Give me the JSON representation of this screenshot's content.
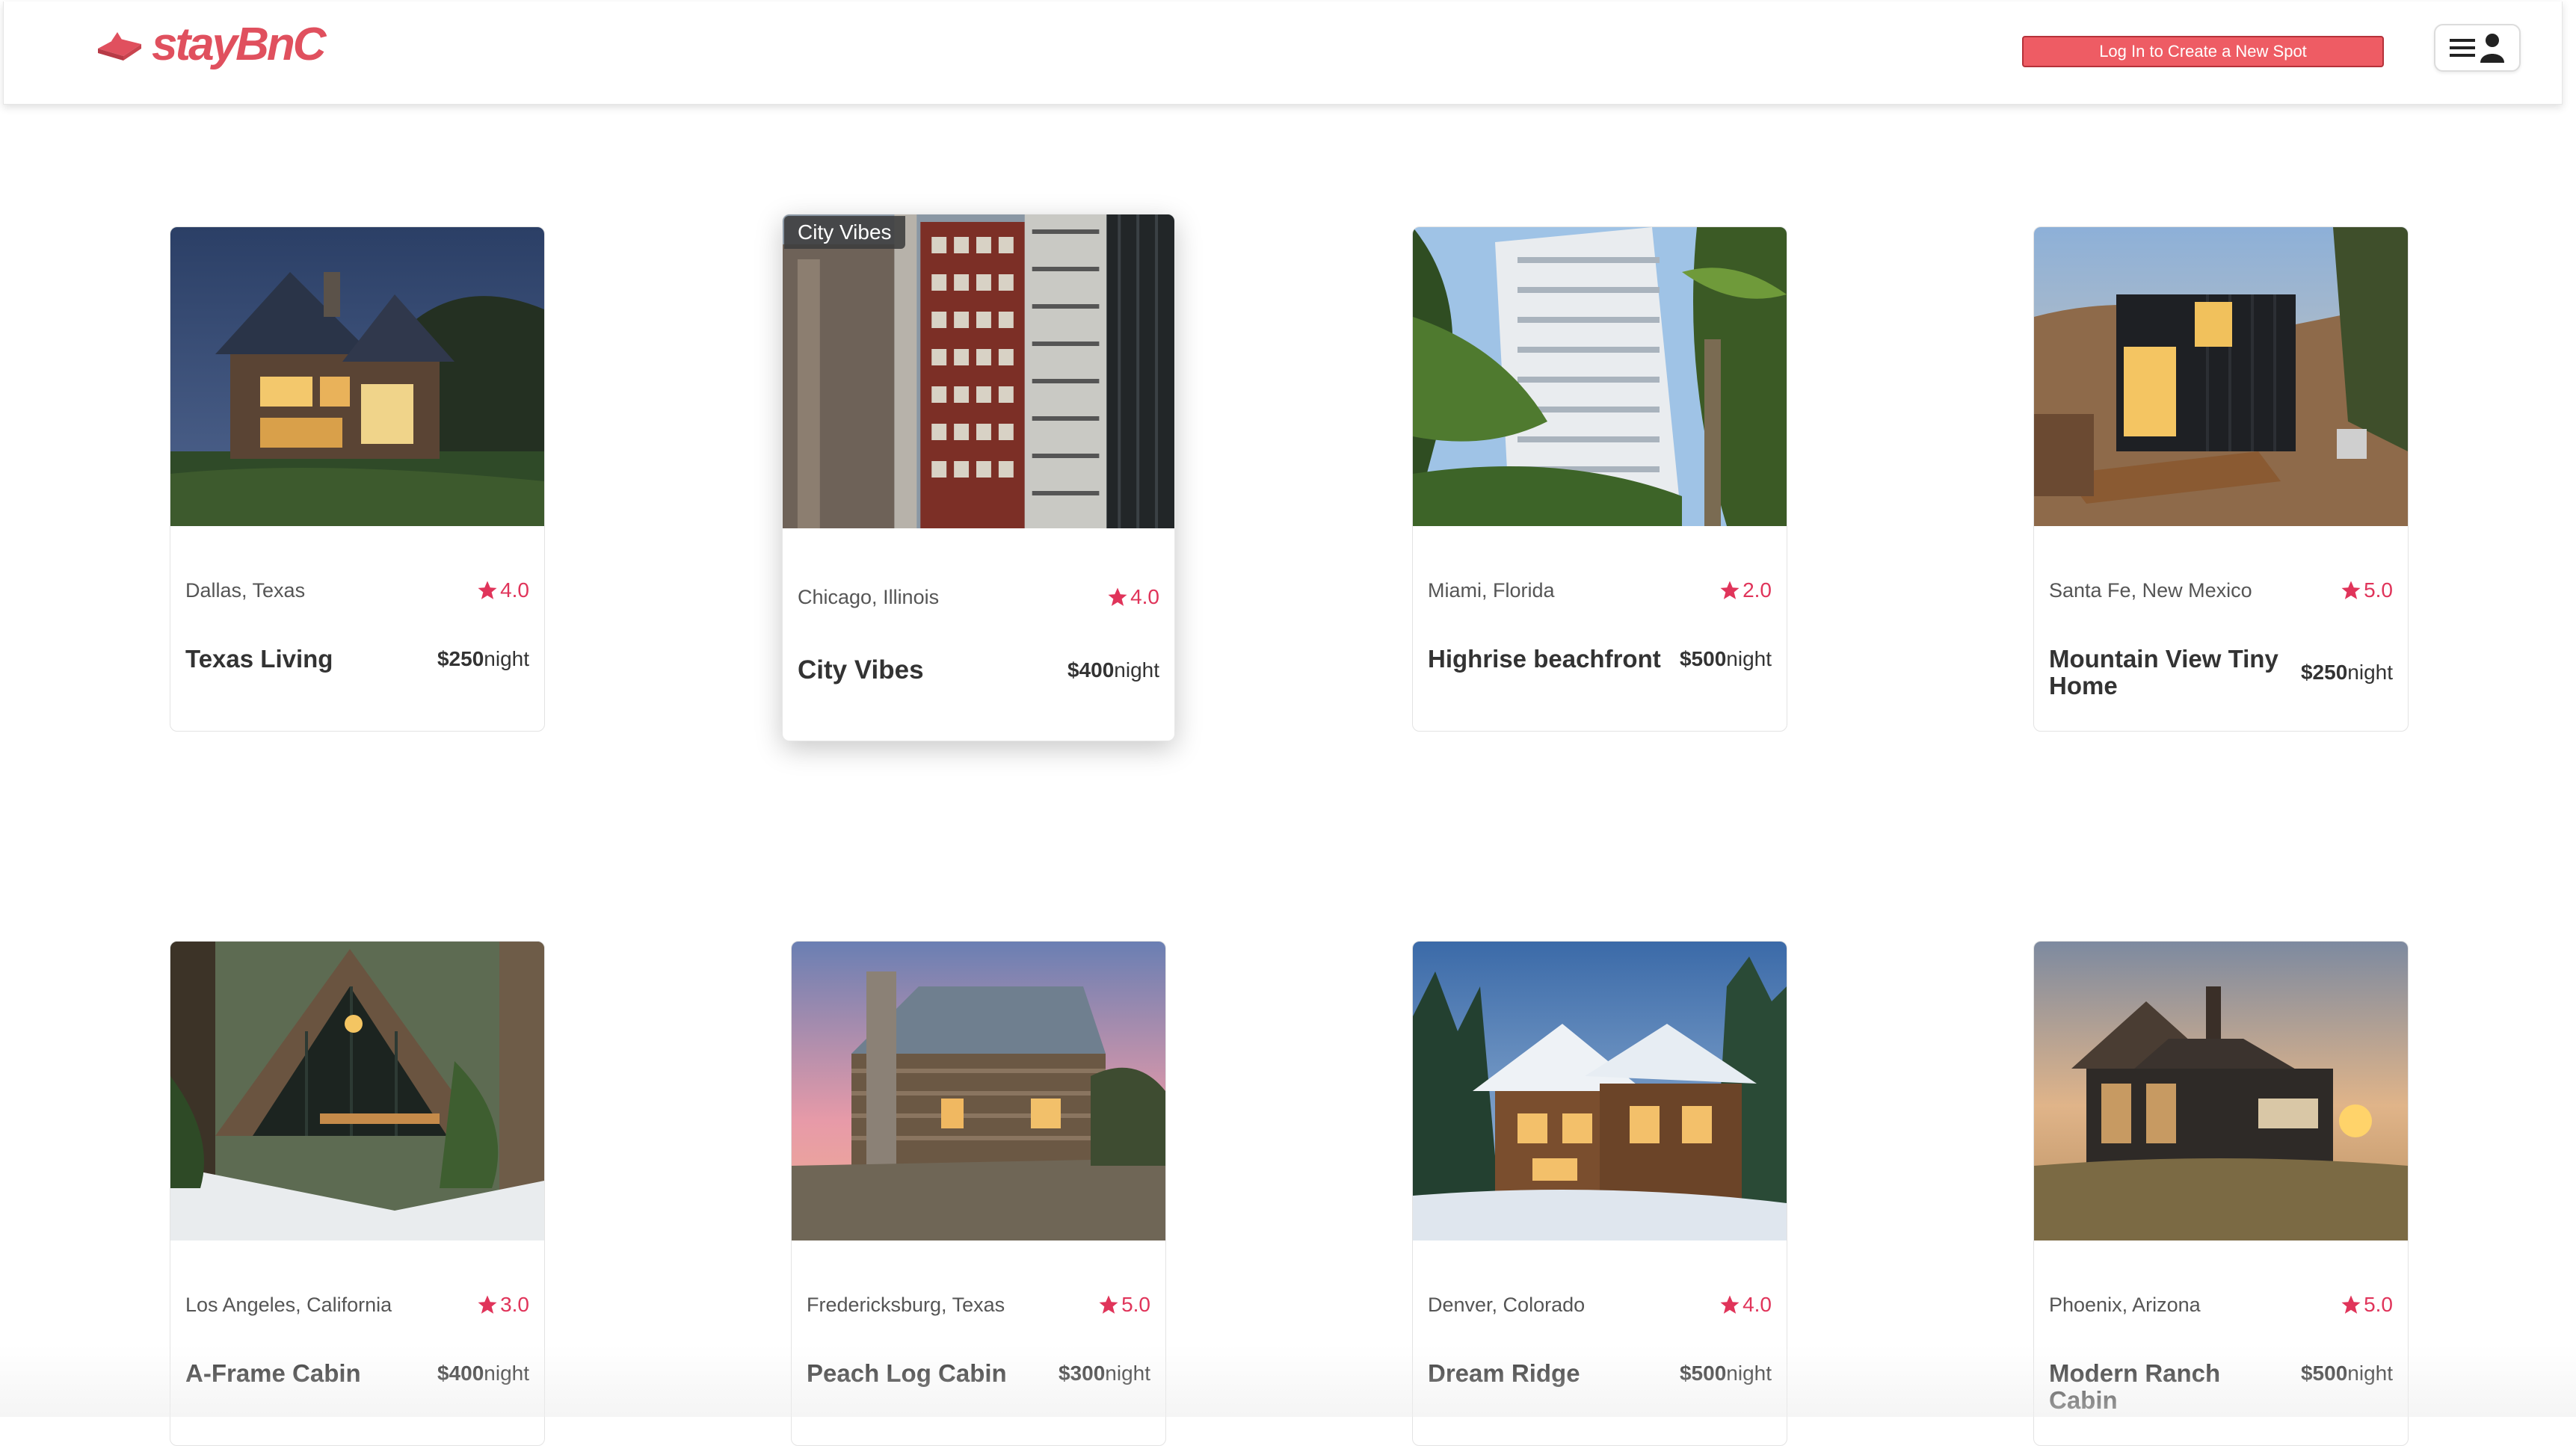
{
  "header": {
    "logo_text": "stayBnC",
    "create_spot_label": "Log In to Create a New Spot",
    "menu_icons": [
      "hamburger-icon",
      "user-icon"
    ]
  },
  "colors": {
    "brand": "#e0505e",
    "button": "#ee5c64",
    "star": "#e0345a"
  },
  "spots": [
    {
      "location": "Dallas, Texas",
      "rating": "4.0",
      "name": "Texas Living",
      "price": "$250",
      "unit": "night"
    },
    {
      "location": "Chicago, Illinois",
      "rating": "4.0",
      "name": "City Vibes",
      "price": "$400",
      "unit": "night",
      "tooltip": "City Vibes"
    },
    {
      "location": "Miami, Florida",
      "rating": "2.0",
      "name": "Highrise beachfront",
      "price": "$500",
      "unit": "night"
    },
    {
      "location": "Santa Fe, New Mexico",
      "rating": "5.0",
      "name": "Mountain View Tiny Home",
      "price": "$250",
      "unit": "night"
    },
    {
      "location": "Los Angeles, California",
      "rating": "3.0",
      "name": "A-Frame Cabin",
      "price": "$400",
      "unit": "night"
    },
    {
      "location": "Fredericksburg, Texas",
      "rating": "5.0",
      "name": "Peach Log Cabin",
      "price": "$300",
      "unit": "night"
    },
    {
      "location": "Denver, Colorado",
      "rating": "4.0",
      "name": "Dream Ridge",
      "price": "$500",
      "unit": "night"
    },
    {
      "location": "Phoenix, Arizona",
      "rating": "5.0",
      "name": "Modern Ranch Cabin",
      "price": "$500",
      "unit": "night"
    }
  ]
}
